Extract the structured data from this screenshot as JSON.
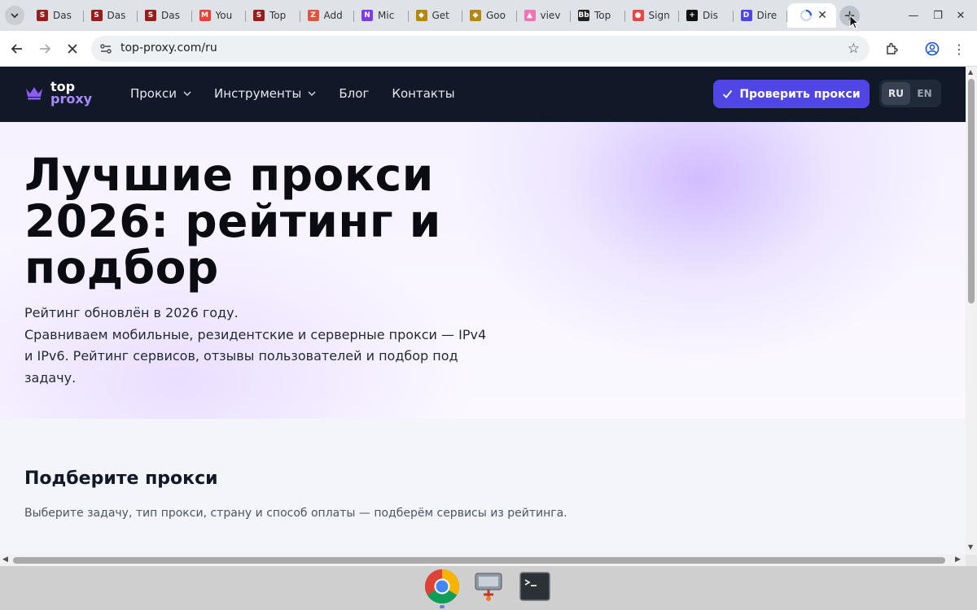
{
  "browser": {
    "tabs": [
      {
        "title": "Das",
        "icon": "s-icon",
        "color": "#9b1c1c",
        "glyph": "S"
      },
      {
        "title": "Das",
        "icon": "s-icon",
        "color": "#9b1c1c",
        "glyph": "S"
      },
      {
        "title": "Das",
        "icon": "s-icon",
        "color": "#9b1c1c",
        "glyph": "S"
      },
      {
        "title": "You",
        "icon": "gmail-icon",
        "color": "#ea4335",
        "glyph": "M"
      },
      {
        "title": "Top",
        "icon": "s-icon",
        "color": "#9b1c1c",
        "glyph": "S"
      },
      {
        "title": "Add",
        "icon": "hatch-icon",
        "color": "#e2553c",
        "glyph": "Z"
      },
      {
        "title": "Mic",
        "icon": "purple-app-icon",
        "color": "#7c3aed",
        "glyph": "N"
      },
      {
        "title": "Get",
        "icon": "shield-icon",
        "color": "#b8860b",
        "glyph": "◆"
      },
      {
        "title": "Goo",
        "icon": "shield-icon",
        "color": "#b8860b",
        "glyph": "◆"
      },
      {
        "title": "viev",
        "icon": "pink-app-icon",
        "color": "#f472b6",
        "glyph": "▲"
      },
      {
        "title": "Top",
        "icon": "bb-icon",
        "color": "#222222",
        "glyph": "Bb"
      },
      {
        "title": "Sign",
        "icon": "brave-icon",
        "color": "#ef4444",
        "glyph": "●"
      },
      {
        "title": "Dis",
        "icon": "plus-circle-icon",
        "color": "#111111",
        "glyph": "+"
      },
      {
        "title": "Dire",
        "icon": "d-icon",
        "color": "#4f46e5",
        "glyph": "D"
      }
    ],
    "active_tab_icon": "loading-icon",
    "url": "top-proxy.com/ru"
  },
  "site": {
    "logo_top": "top",
    "logo_proxy": "proxy",
    "nav": {
      "proxies": "Прокси",
      "tools": "Инструменты",
      "blog": "Блог",
      "contacts": "Контакты"
    },
    "check_button": "Проверить прокси",
    "lang_ru": "RU",
    "lang_en": "EN",
    "accent_color": "#4f46e5"
  },
  "hero": {
    "title": "Лучшие прокси 2026: рейтинг и подбор",
    "line1": "Рейтинг обновлён в 2026 году.",
    "line2": "Сравниваем мобильные, резидентские и серверные прокси — IPv4 и IPv6. Рейтинг сервисов, отзывы пользователей и подбор под задачу."
  },
  "picker": {
    "title": "Подберите прокси",
    "subtitle": "Выберите задачу, тип прокси, страну и способ оплаты — подберём сервисы из рейтинга."
  },
  "taskbar": {
    "items": [
      "chrome-icon",
      "network-icon",
      "terminal-icon"
    ]
  }
}
